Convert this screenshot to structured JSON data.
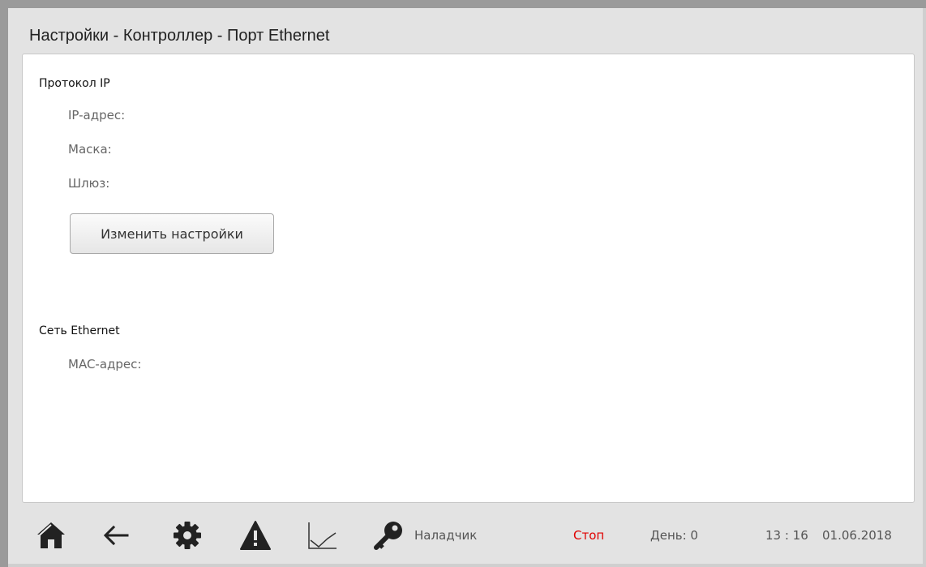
{
  "header": {
    "title": "Настройки - Контроллер - Порт Ethernet"
  },
  "ip_section": {
    "heading": "Протокол IP",
    "ip_label": "IP-адрес:",
    "mask_label": "Маска:",
    "gateway_label": "Шлюз:",
    "change_button": "Изменить настройки"
  },
  "ethernet_section": {
    "heading": "Сеть Ethernet",
    "mac_label": "MAC-адрес:"
  },
  "toolbar": {
    "icons": [
      "home-icon",
      "back-arrow-icon",
      "gear-icon",
      "warning-icon",
      "chart-icon",
      "key-icon"
    ],
    "user_role": "Наладчик",
    "status": "Стоп",
    "status_color": "#e00000",
    "day": "День: 0",
    "time": "13 : 16",
    "date": "01.06.2018"
  }
}
